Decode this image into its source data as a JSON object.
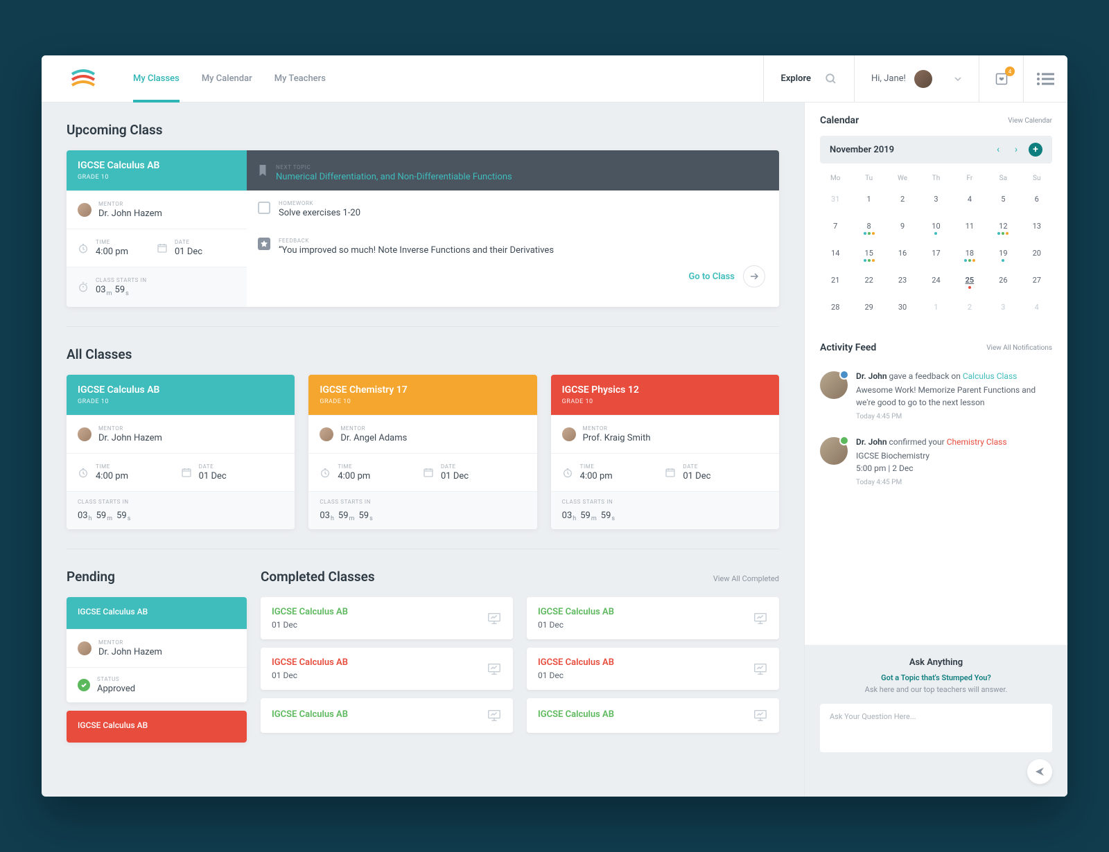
{
  "nav": {
    "items": [
      "My Classes",
      "My Calendar",
      "My Teachers"
    ],
    "explore": "Explore"
  },
  "user": {
    "greeting": "Hi, Jane!"
  },
  "fav_badge": "4",
  "sections": {
    "upcoming": "Upcoming Class",
    "all": "All Classes",
    "pending": "Pending",
    "completed": "Completed Classes",
    "view_completed": "View All Completed"
  },
  "upcoming": {
    "title": "IGCSE Calculus AB",
    "grade": "GRADE 10",
    "mentor_lbl": "MENTOR",
    "mentor": "Dr. John Hazem",
    "time_lbl": "TIME",
    "time": "4:00 pm",
    "date_lbl": "DATE",
    "date": "01 Dec",
    "starts_lbl": "CLASS STARTS IN",
    "m": "03",
    "s": "59",
    "next_lbl": "NEXT TOPIC",
    "next": "Numerical Differentiation, and Non-Differentiable Functions",
    "hw_lbl": "HOMEWORK",
    "hw": "Solve exercises 1-20",
    "fb_lbl": "FEEDBACK",
    "fb": "“You improved so much! Note Inverse Functions and their Derivatives",
    "goto": "Go to Class"
  },
  "all_classes": [
    {
      "title": "IGCSE Calculus AB",
      "grade": "GRADE 10",
      "mentor": "Dr. John Hazem",
      "time": "4:00 pm",
      "date": "01 Dec",
      "h": "03",
      "m": "59",
      "s": "59",
      "cls": "teal-bg"
    },
    {
      "title": "IGCSE Chemistry 17",
      "grade": "GRADE 10",
      "mentor": "Dr. Angel Adams",
      "time": "4:00 pm",
      "date": "01 Dec",
      "h": "03",
      "m": "59",
      "s": "59",
      "cls": "orange-bg"
    },
    {
      "title": "IGCSE Physics 12",
      "grade": "GRADE 10",
      "mentor": "Prof. Kraig Smith",
      "time": "4:00 pm",
      "date": "01 Dec",
      "h": "03",
      "m": "59",
      "s": "59",
      "cls": "red-bg"
    }
  ],
  "labels": {
    "mentor": "MENTOR",
    "time": "TIME",
    "date": "DATE",
    "starts": "CLASS STARTS IN",
    "status": "STATUS"
  },
  "pending": [
    {
      "title": "IGCSE Calculus AB",
      "mentor": "Dr. John Hazem",
      "status": "Approved",
      "cls": "teal-bg"
    },
    {
      "title": "IGCSE Calculus AB",
      "cls": "red-bg"
    }
  ],
  "completed": [
    [
      {
        "title": "IGCSE Calculus AB",
        "date": "01 Dec",
        "c": "green"
      },
      {
        "title": "IGCSE Calculus AB",
        "date": "01 Dec",
        "c": "green"
      }
    ],
    [
      {
        "title": "IGCSE Calculus AB",
        "date": "01 Dec",
        "c": "red"
      },
      {
        "title": "IGCSE Calculus AB",
        "date": "01 Dec",
        "c": "red"
      }
    ],
    [
      {
        "title": "IGCSE Calculus AB",
        "date": "",
        "c": "green"
      },
      {
        "title": "IGCSE Calculus AB",
        "date": "",
        "c": "green"
      }
    ]
  ],
  "calendar": {
    "title": "Calendar",
    "view": "View Calendar",
    "month": "November 2019",
    "dows": [
      "Mo",
      "Tu",
      "We",
      "Th",
      "Fr",
      "Sa",
      "Su"
    ],
    "days": [
      {
        "n": "31",
        "mute": true
      },
      {
        "n": "1"
      },
      {
        "n": "2"
      },
      {
        "n": "3"
      },
      {
        "n": "4"
      },
      {
        "n": "5"
      },
      {
        "n": "6"
      },
      {
        "n": "7"
      },
      {
        "n": "8",
        "dots": [
          "#3fbcbc",
          "#5cb85c",
          "#f5a62e"
        ]
      },
      {
        "n": "9"
      },
      {
        "n": "10",
        "dots": [
          "#3fbcbc"
        ]
      },
      {
        "n": "11"
      },
      {
        "n": "12",
        "dots": [
          "#3fbcbc",
          "#5cb85c",
          "#f5a62e"
        ]
      },
      {
        "n": "13"
      },
      {
        "n": "14"
      },
      {
        "n": "15",
        "dots": [
          "#3fbcbc",
          "#5cb85c",
          "#f5a62e"
        ]
      },
      {
        "n": "16"
      },
      {
        "n": "17"
      },
      {
        "n": "18",
        "dots": [
          "#3fbcbc",
          "#5cb85c",
          "#f5a62e"
        ]
      },
      {
        "n": "19",
        "dots": [
          "#3fbcbc"
        ]
      },
      {
        "n": "20"
      },
      {
        "n": "21"
      },
      {
        "n": "22"
      },
      {
        "n": "23"
      },
      {
        "n": "24"
      },
      {
        "n": "25",
        "today": true,
        "dots": [
          "#e84c3d"
        ]
      },
      {
        "n": "26"
      },
      {
        "n": "27"
      },
      {
        "n": "28"
      },
      {
        "n": "29"
      },
      {
        "n": "30"
      },
      {
        "n": "1",
        "mute": true
      },
      {
        "n": "2",
        "mute": true
      },
      {
        "n": "3",
        "mute": true
      },
      {
        "n": "4",
        "mute": true
      }
    ]
  },
  "activity": {
    "title": "Activity Feed",
    "view": "View All Notifications",
    "items": [
      {
        "who": "Dr. John",
        "action": "gave a feedback on",
        "link": "Calculus Class",
        "link_cls": "lk",
        "body": "Awesome Work! Memorize Parent Functions and we're good to go to the next lesson",
        "time": "Today 4:45 PM",
        "status": "blue"
      },
      {
        "who": "Dr. John",
        "action": "confirmed your",
        "link": "Chemistry Class",
        "link_cls": "lk-red",
        "body": "IGCSE Biochemistry\n5:00 pm | 2 Dec",
        "time": "Today 4:45 PM",
        "status": "green"
      }
    ]
  },
  "ask": {
    "title": "Ask Anything",
    "q": "Got a Topic that's Stumped You?",
    "sub": "Ask here and our top teachers will answer.",
    "placeholder": "Ask Your Question Here..."
  }
}
